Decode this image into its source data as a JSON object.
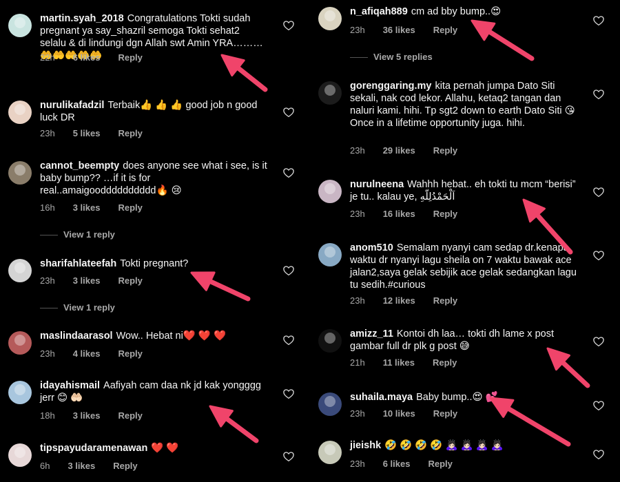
{
  "colors": {
    "background": "#000000",
    "text": "#f5f5f5",
    "meta": "#a8a8a8",
    "arrow": "#f0446a"
  },
  "left_comments": [
    {
      "username": "martin.syah_2018",
      "text": "Congratulations Tokti sudah pregnant ya say_shazril semoga Tokti sehat2 selalu & di lindungi dgn Allah swt Amin YRA………🤲🤲🤲🤲🤲",
      "time": "22h",
      "likes": "6 likes",
      "reply": "Reply"
    },
    {
      "username": "nurulikafadzil",
      "text": "Terbaik👍 👍 👍 good job n good luck DR",
      "time": "23h",
      "likes": "5 likes",
      "reply": "Reply"
    },
    {
      "username": "cannot_beempty",
      "text": "does anyone see what i see, is it baby bump?? …if it is for real..amaigoodddddddddd🔥 😢",
      "time": "16h",
      "likes": "3 likes",
      "reply": "Reply",
      "view_replies": "View 1 reply"
    },
    {
      "username": "sharifahlateefah",
      "text": "Tokti pregnant?",
      "time": "23h",
      "likes": "3 likes",
      "reply": "Reply",
      "view_replies": "View 1 reply"
    },
    {
      "username": "maslindaarasol",
      "text": "Wow.. Hebat ni❤️ ❤️ ❤️",
      "time": "23h",
      "likes": "4 likes",
      "reply": "Reply"
    },
    {
      "username": "idayahismail",
      "text": "Aafiyah cam daa nk jd kak yongggg jerr 😊 🤲🏻",
      "time": "18h",
      "likes": "3 likes",
      "reply": "Reply"
    },
    {
      "username": "tipspayudaramenawan",
      "text": "❤️ ❤️",
      "time": "6h",
      "likes": "3 likes",
      "reply": "Reply"
    }
  ],
  "right_comments": [
    {
      "username": "n_afiqah889",
      "text": "cm ad bby bump..😍",
      "time": "23h",
      "likes": "36 likes",
      "reply": "Reply",
      "view_replies": "View 5 replies"
    },
    {
      "username": "gorenggaring.my",
      "text": "kita pernah jumpa Dato Siti sekali, nak cod lekor. Allahu, ketaq2 tangan dan naluri kami. hihi. Tp sgt2 down to earth Dato Siti 😘 Once in a lifetime opportunity juga. hihi.",
      "time": "23h",
      "likes": "29 likes",
      "reply": "Reply"
    },
    {
      "username": "nurulneena",
      "text": "Wahhh hebat.. eh tokti tu mcm “berisi” je tu.. kalau ye, اَلْحَمْدُلِلّهِ",
      "time": "23h",
      "likes": "16 likes",
      "reply": "Reply"
    },
    {
      "username": "anom510",
      "text": "Semalam nyanyi cam sedap dr.kenapa waktu dr nyanyi lagu sheila on 7 waktu bawak ace jalan2,saya gelak sebijik ace gelak sedangkan lagu tu sedih.#curious",
      "time": "23h",
      "likes": "12 likes",
      "reply": "Reply"
    },
    {
      "username": "amizz_11",
      "text": "Kontoi dh laa… tokti dh lame x post gambar full dr plk g post 😅",
      "time": "21h",
      "likes": "11 likes",
      "reply": "Reply"
    },
    {
      "username": "suhaila.maya",
      "text": "Baby bump..😍 💕",
      "time": "23h",
      "likes": "10 likes",
      "reply": "Reply"
    },
    {
      "username": "jieishk",
      "text": "🤣 🤣 🤣 🤣 🙇🏻‍♀️ 🙇🏻‍♀️ 🙇🏻‍♀️ 🙇🏻‍♀️",
      "time": "23h",
      "likes": "6 likes",
      "reply": "Reply"
    }
  ],
  "icons": {
    "like": "heart-outline-icon",
    "annotation": "pink-arrow-icon"
  }
}
